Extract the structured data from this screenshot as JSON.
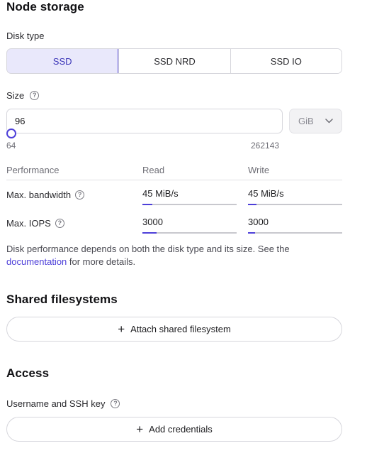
{
  "node_storage": {
    "title": "Node storage",
    "disk_type_label": "Disk type",
    "disk_types": [
      {
        "label": "SSD",
        "selected": true
      },
      {
        "label": "SSD NRD",
        "selected": false
      },
      {
        "label": "SSD IO",
        "selected": false
      }
    ],
    "size_label": "Size",
    "size_value": "96",
    "size_unit": "GiB",
    "size_min": "64",
    "size_max": "262143",
    "performance": {
      "header": "Performance",
      "read_header": "Read",
      "write_header": "Write",
      "rows": [
        {
          "label": "Max. bandwidth",
          "read": "45 MiB/s",
          "write": "45 MiB/s"
        },
        {
          "label": "Max. IOPS",
          "read": "3000",
          "write": "3000"
        }
      ]
    },
    "note_before": "Disk performance depends on both the disk type and its size. See the ",
    "note_link": "documentation",
    "note_after": " for more details."
  },
  "shared_filesystems": {
    "title": "Shared filesystems",
    "attach_label": "Attach shared filesystem"
  },
  "access": {
    "title": "Access",
    "credentials_label": "Username and SSH key",
    "add_credentials_label": "Add credentials"
  },
  "colors": {
    "accent": "#4d3fd9",
    "selected_bg": "#e9e8fb"
  },
  "icons": [
    "help-icon",
    "chevron-down-icon",
    "plus-icon"
  ]
}
